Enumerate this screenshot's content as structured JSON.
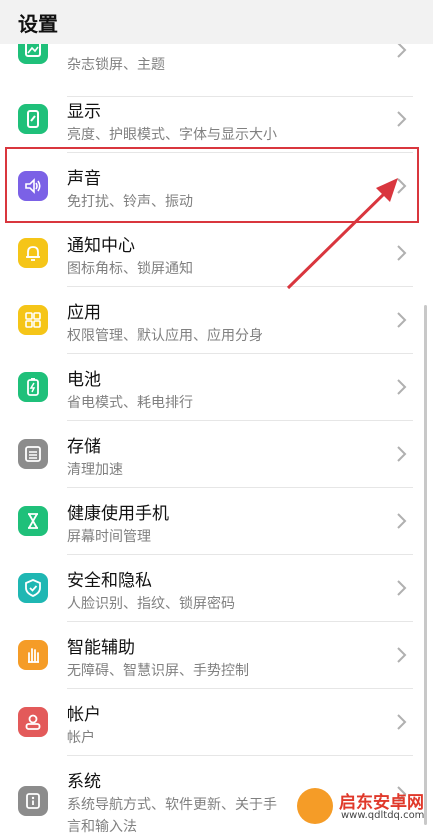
{
  "header": {
    "title": "设置"
  },
  "colors": {
    "green": "#1fc07a",
    "purple": "#7b61e6",
    "yellow": "#f5c518",
    "gray": "#8c8c8c",
    "teal": "#1fb7b3",
    "orange": "#f59c27",
    "red": "#e35a5a",
    "highlight": "#d9363e"
  },
  "items": [
    {
      "label": "",
      "sub": "杂志锁屏、主题",
      "icon": "wallpaper-icon"
    },
    {
      "label": "显示",
      "sub": "亮度、护眼模式、字体与显示大小",
      "icon": "display-icon"
    },
    {
      "label": "声音",
      "sub": "免打扰、铃声、振动",
      "icon": "sound-icon"
    },
    {
      "label": "通知中心",
      "sub": "图标角标、锁屏通知",
      "icon": "bell-icon"
    },
    {
      "label": "应用",
      "sub": "权限管理、默认应用、应用分身",
      "icon": "apps-grid-icon"
    },
    {
      "label": "电池",
      "sub": "省电模式、耗电排行",
      "icon": "battery-icon"
    },
    {
      "label": "存储",
      "sub": "清理加速",
      "icon": "storage-icon"
    },
    {
      "label": "健康使用手机",
      "sub": "屏幕时间管理",
      "icon": "hourglass-icon"
    },
    {
      "label": "安全和隐私",
      "sub": "人脸识别、指纹、锁屏密码",
      "icon": "shield-icon"
    },
    {
      "label": "智能辅助",
      "sub": "无障碍、智慧识屏、手势控制",
      "icon": "hand-icon"
    },
    {
      "label": "帐户",
      "sub": "帐户",
      "icon": "account-icon"
    },
    {
      "label": "系统",
      "sub": "系统导航方式、软件更新、关于手",
      "sub2": "言和输入法",
      "icon": "info-icon"
    }
  ],
  "watermark": {
    "name": "启东安卓网",
    "url": "www.qdltdq.com"
  }
}
